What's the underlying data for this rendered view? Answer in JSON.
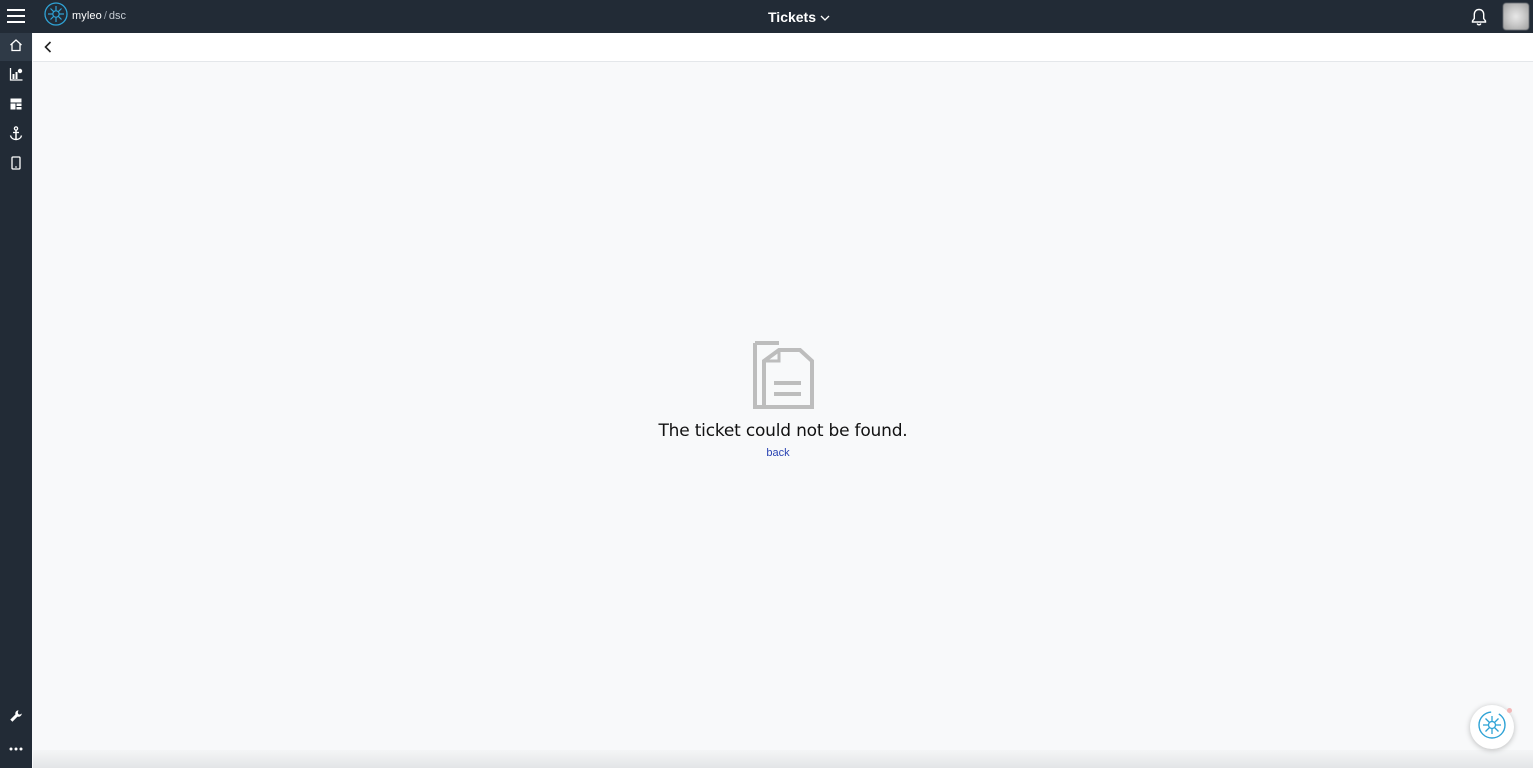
{
  "header": {
    "brand": "myleo",
    "separator": "/",
    "environment": "dsc",
    "module_title": "Tickets"
  },
  "sidebar": {
    "items": [
      {
        "icon": "home-icon"
      },
      {
        "icon": "chart-icon"
      },
      {
        "icon": "dashboard-icon"
      },
      {
        "icon": "anchor-icon"
      },
      {
        "icon": "mobile-icon"
      }
    ],
    "bottom_items": [
      {
        "icon": "wrench-icon"
      },
      {
        "icon": "more-icon"
      }
    ]
  },
  "empty_state": {
    "message": "The ticket could not be found.",
    "back_label": "back"
  },
  "colors": {
    "topbar": "#222b36",
    "accent": "#2fa3d6",
    "link": "#2a44b3"
  }
}
